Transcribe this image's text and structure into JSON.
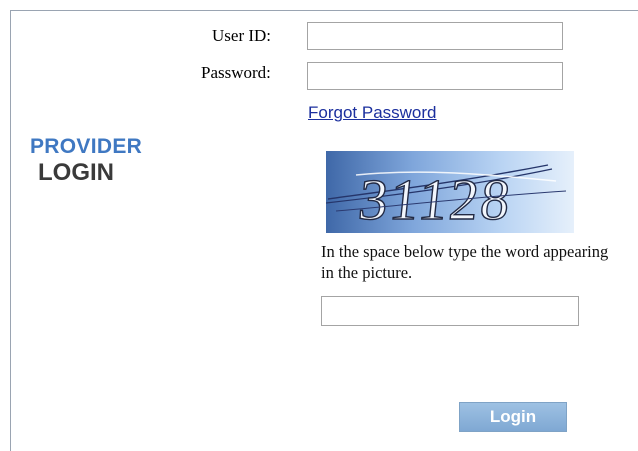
{
  "brand": {
    "line1": "PROVIDER",
    "line2": "LOGIN",
    "line1_color": "#3f78c2",
    "line2_color": "#3a3a3a"
  },
  "form": {
    "userid_label": "User ID:",
    "userid_value": "",
    "password_label": "Password:",
    "password_value": "",
    "forgot_link": "Forgot Password"
  },
  "captcha": {
    "image_text": "31128",
    "instruction": "In the space below type the word appearing in the picture.",
    "input_value": ""
  },
  "actions": {
    "login_label": "Login",
    "login_color": "#8db4dc"
  }
}
